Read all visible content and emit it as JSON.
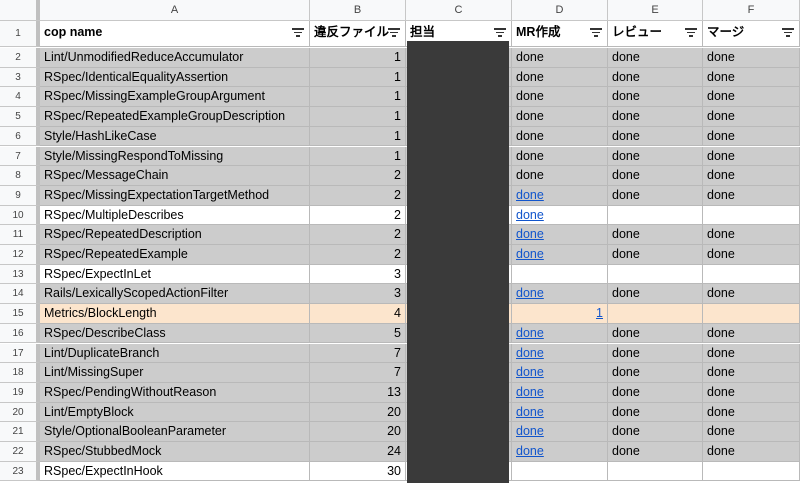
{
  "columns": [
    {
      "letter": "A"
    },
    {
      "letter": "B"
    },
    {
      "letter": "C"
    },
    {
      "letter": "D"
    },
    {
      "letter": "E"
    },
    {
      "letter": "F"
    }
  ],
  "header": {
    "row_number": "1",
    "cop_name": "cop name",
    "files": "違反ファイル",
    "assignee": "担当",
    "mr": "MR作成",
    "review": "レビュー",
    "merge": "マージ"
  },
  "colors": {
    "done_row": "#cccccc",
    "highlight_row": "#fce5cd",
    "plain_row": "#ffffff",
    "link": "#1155cc",
    "redaction": "#3a3a3a"
  },
  "rows": [
    {
      "n": "2",
      "name": "Lint/UnmodifiedReduceAccumulator",
      "count": "1",
      "mr": "done",
      "review": "done",
      "merge": "done",
      "style": "gray",
      "mr_link": false
    },
    {
      "n": "3",
      "name": "RSpec/IdenticalEqualityAssertion",
      "count": "1",
      "mr": "done",
      "review": "done",
      "merge": "done",
      "style": "gray",
      "mr_link": false
    },
    {
      "n": "4",
      "name": "RSpec/MissingExampleGroupArgument",
      "count": "1",
      "mr": "done",
      "review": "done",
      "merge": "done",
      "style": "gray",
      "mr_link": false
    },
    {
      "n": "5",
      "name": "RSpec/RepeatedExampleGroupDescription",
      "count": "1",
      "mr": "done",
      "review": "done",
      "merge": "done",
      "style": "gray",
      "mr_link": false
    },
    {
      "n": "6",
      "name": "Style/HashLikeCase",
      "count": "1",
      "mr": "done",
      "review": "done",
      "merge": "done",
      "style": "gray",
      "mr_link": false
    },
    {
      "n": "7",
      "name": "Style/MissingRespondToMissing",
      "count": "1",
      "mr": "done",
      "review": "done",
      "merge": "done",
      "style": "gray",
      "mr_link": false
    },
    {
      "n": "8",
      "name": "RSpec/MessageChain",
      "count": "2",
      "mr": "done",
      "review": "done",
      "merge": "done",
      "style": "gray",
      "mr_link": false
    },
    {
      "n": "9",
      "name": "RSpec/MissingExpectationTargetMethod",
      "count": "2",
      "mr": "done",
      "review": "done",
      "merge": "done",
      "style": "gray",
      "mr_link": true
    },
    {
      "n": "10",
      "name": "RSpec/MultipleDescribes",
      "count": "2",
      "mr": "done",
      "review": "",
      "merge": "",
      "style": "white",
      "mr_link": true
    },
    {
      "n": "11",
      "name": "RSpec/RepeatedDescription",
      "count": "2",
      "mr": "done",
      "review": "done",
      "merge": "done",
      "style": "gray",
      "mr_link": true
    },
    {
      "n": "12",
      "name": "RSpec/RepeatedExample",
      "count": "2",
      "mr": "done",
      "review": "done",
      "merge": "done",
      "style": "gray",
      "mr_link": true
    },
    {
      "n": "13",
      "name": "RSpec/ExpectInLet",
      "count": "3",
      "mr": "",
      "review": "",
      "merge": "",
      "style": "white",
      "mr_link": false
    },
    {
      "n": "14",
      "name": "Rails/LexicallyScopedActionFilter",
      "count": "3",
      "mr": "done",
      "review": "done",
      "merge": "done",
      "style": "gray",
      "mr_link": true
    },
    {
      "n": "15",
      "name": "Metrics/BlockLength",
      "count": "4",
      "mr": "1",
      "review": "",
      "merge": "",
      "style": "orange",
      "mr_link": true
    },
    {
      "n": "16",
      "name": "RSpec/DescribeClass",
      "count": "5",
      "mr": "done",
      "review": "done",
      "merge": "done",
      "style": "gray",
      "mr_link": true
    },
    {
      "n": "17",
      "name": "Lint/DuplicateBranch",
      "count": "7",
      "mr": "done",
      "review": "done",
      "merge": "done",
      "style": "gray",
      "mr_link": true
    },
    {
      "n": "18",
      "name": "Lint/MissingSuper",
      "count": "7",
      "mr": "done",
      "review": "done",
      "merge": "done",
      "style": "gray",
      "mr_link": true
    },
    {
      "n": "19",
      "name": "RSpec/PendingWithoutReason",
      "count": "13",
      "mr": "done",
      "review": "done",
      "merge": "done",
      "style": "gray",
      "mr_link": true
    },
    {
      "n": "20",
      "name": "Lint/EmptyBlock",
      "count": "20",
      "mr": "done",
      "review": "done",
      "merge": "done",
      "style": "gray",
      "mr_link": true
    },
    {
      "n": "21",
      "name": "Style/OptionalBooleanParameter",
      "count": "20",
      "mr": "done",
      "review": "done",
      "merge": "done",
      "style": "gray",
      "mr_link": true
    },
    {
      "n": "22",
      "name": "RSpec/StubbedMock",
      "count": "24",
      "mr": "done",
      "review": "done",
      "merge": "done",
      "style": "gray",
      "mr_link": true
    },
    {
      "n": "23",
      "name": "RSpec/ExpectInHook",
      "count": "30",
      "mr": "",
      "review": "",
      "merge": "",
      "style": "white",
      "mr_link": false
    }
  ]
}
